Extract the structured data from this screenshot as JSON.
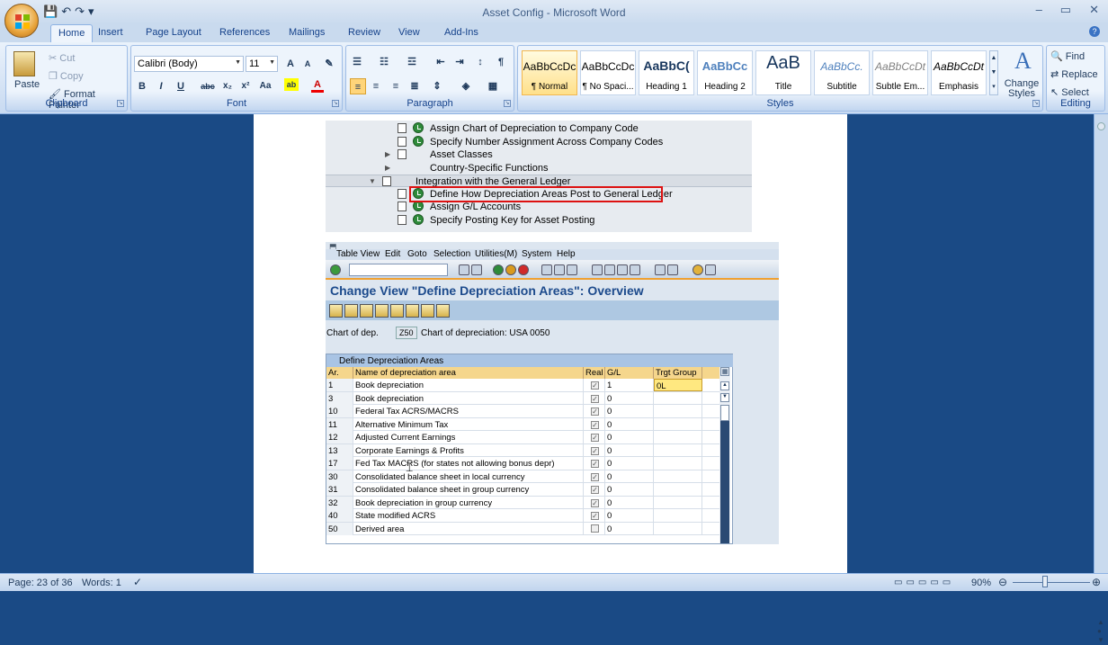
{
  "window": {
    "title": "Asset Config - Microsoft Word",
    "controls": [
      "–",
      "▭",
      "✕"
    ]
  },
  "qat": {
    "save": "💾",
    "undo": "↶",
    "redo": "↷",
    "more": "▾"
  },
  "tabs": [
    "Home",
    "Insert",
    "Page Layout",
    "References",
    "Mailings",
    "Review",
    "View",
    "Add-Ins"
  ],
  "ribbon": {
    "clipboard": {
      "label": "Clipboard",
      "paste": "Paste",
      "cut": "Cut",
      "copy": "Copy",
      "format_painter": "Format Painter"
    },
    "font": {
      "label": "Font",
      "font_name": "Calibri (Body)",
      "font_size": "11"
    },
    "paragraph": {
      "label": "Paragraph"
    },
    "styles": {
      "label": "Styles",
      "items": [
        {
          "sample": "AaBbCcDc",
          "name": "¶ Normal"
        },
        {
          "sample": "AaBbCcDc",
          "name": "¶ No Spaci..."
        },
        {
          "sample": "AaBbC(",
          "name": "Heading 1"
        },
        {
          "sample": "AaBbCc",
          "name": "Heading 2"
        },
        {
          "sample": "AaB",
          "name": "Title"
        },
        {
          "sample": "AaBbCc.",
          "name": "Subtitle"
        },
        {
          "sample": "AaBbCcDt",
          "name": "Subtle Em..."
        },
        {
          "sample": "AaBbCcDt",
          "name": "Emphasis"
        }
      ],
      "change_styles": "Change Styles"
    },
    "editing": {
      "label": "Editing",
      "find": "Find",
      "replace": "Replace",
      "select": "Select"
    }
  },
  "sap_tree": {
    "rows": [
      "Assign Chart of Depreciation to Company Code",
      "Specify Number Assignment Across Company Codes",
      "Asset Classes",
      "Country-Specific Functions",
      "Integration with the General Ledger",
      "Define How Depreciation Areas Post to General Ledger",
      "Assign G/L Accounts",
      "Specify Posting Key for Asset Posting"
    ]
  },
  "sap": {
    "menu": [
      "Table View",
      "Edit",
      "Goto",
      "Selection",
      "Utilities(M)",
      "System",
      "Help"
    ],
    "title": "Change View \"Define Depreciation Areas\": Overview",
    "chart_label": "Chart of dep.",
    "chart_value": "Z50",
    "chart_desc": "Chart of depreciation: USA 0050",
    "table_title": "Define Depreciation Areas",
    "headers": [
      "Ar.",
      "Name of depreciation area",
      "Real",
      "G/L",
      "Trgt Group"
    ],
    "rows": [
      {
        "ar": "1",
        "name": "Book depreciation",
        "real": true,
        "gl": "1",
        "tg": "0L"
      },
      {
        "ar": "3",
        "name": "Book depreciation",
        "real": true,
        "gl": "0",
        "tg": ""
      },
      {
        "ar": "10",
        "name": "Federal Tax ACRS/MACRS",
        "real": true,
        "gl": "0",
        "tg": ""
      },
      {
        "ar": "11",
        "name": "Alternative Minimum Tax",
        "real": true,
        "gl": "0",
        "tg": ""
      },
      {
        "ar": "12",
        "name": "Adjusted Current Earnings",
        "real": true,
        "gl": "0",
        "tg": ""
      },
      {
        "ar": "13",
        "name": "Corporate Earnings & Profits",
        "real": true,
        "gl": "0",
        "tg": ""
      },
      {
        "ar": "17",
        "name": "Fed Tax MACRS (for states not allowing bonus depr)",
        "real": true,
        "gl": "0",
        "tg": ""
      },
      {
        "ar": "30",
        "name": "Consolidated balance sheet in local currency",
        "real": true,
        "gl": "0",
        "tg": ""
      },
      {
        "ar": "31",
        "name": "Consolidated balance sheet in group currency",
        "real": true,
        "gl": "0",
        "tg": ""
      },
      {
        "ar": "32",
        "name": "Book depreciation in group currency",
        "real": true,
        "gl": "0",
        "tg": ""
      },
      {
        "ar": "40",
        "name": "State modified ACRS",
        "real": true,
        "gl": "0",
        "tg": ""
      },
      {
        "ar": "50",
        "name": "Derived area",
        "real": false,
        "gl": "0",
        "tg": ""
      }
    ]
  },
  "status": {
    "page": "Page: 23 of 36",
    "words": "Words: 1",
    "zoom": "90%"
  }
}
